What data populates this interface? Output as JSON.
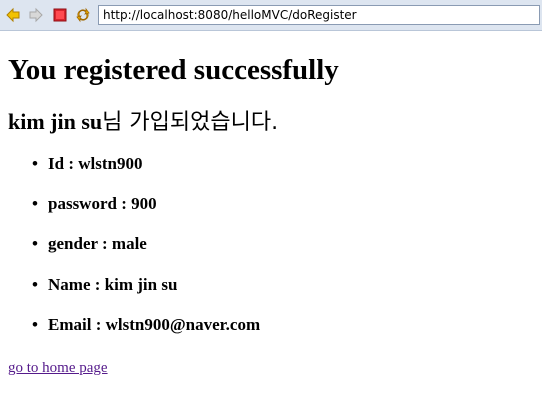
{
  "browser": {
    "url": "http://localhost:8080/helloMVC/doRegister",
    "icons": [
      "back-arrow-icon",
      "forward-arrow-icon",
      "stop-icon",
      "refresh-icon"
    ],
    "colors": {
      "toolbar_bg": "#dde5f0",
      "back_arrow": "#e8b100",
      "forward_arrow": "#c0c0c0",
      "stop": "#d9242c",
      "refresh": "#e8a000"
    }
  },
  "page": {
    "heading": "You registered successfully",
    "subheading_name": "kim jin su",
    "subheading_suffix": "님 가입되었습니다.",
    "fields": [
      {
        "label": "Id",
        "value": "wlstn900"
      },
      {
        "label": "password",
        "value": "900"
      },
      {
        "label": "gender",
        "value": "male"
      },
      {
        "label": "Name",
        "value": "kim jin su"
      },
      {
        "label": "Email",
        "value": "wlstn900@naver.com"
      }
    ],
    "bullet": "•",
    "home_link": "go to home page",
    "link_color": "#551a8b"
  }
}
